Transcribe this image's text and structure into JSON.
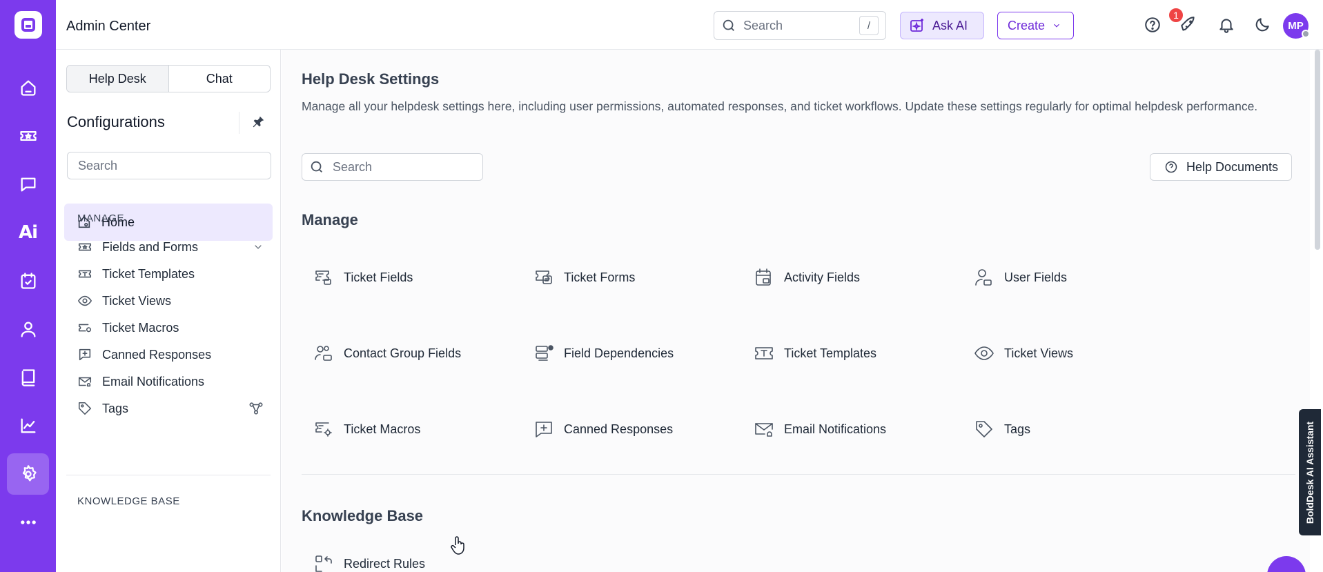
{
  "app": {
    "title": "Admin Center"
  },
  "topbar": {
    "search_placeholder": "Search",
    "search_shortcut": "/",
    "ask_ai_label": "Ask AI",
    "create_label": "Create",
    "notification_count": "1",
    "avatar_initials": "MP"
  },
  "sidebar": {
    "tabs": [
      "Help Desk",
      "Chat"
    ],
    "title": "Configurations",
    "search_placeholder": "Search",
    "home_label": "Home",
    "manage_heading": "MANAGE",
    "items": [
      "Fields and Forms",
      "Ticket Templates",
      "Ticket Views",
      "Ticket Macros",
      "Canned Responses",
      "Email Notifications",
      "Tags"
    ],
    "kb_heading": "KNOWLEDGE BASE"
  },
  "main": {
    "title": "Help Desk Settings",
    "description": "Manage all your helpdesk settings here, including user permissions, automated responses, and ticket workflows. Update these settings regularly for optimal helpdesk performance.",
    "search_placeholder": "Search",
    "help_docs_label": "Help Documents",
    "manage_title": "Manage",
    "manage_items": [
      "Ticket Fields",
      "Ticket Forms",
      "Activity Fields",
      "User Fields",
      "Contact Group Fields",
      "Field Dependencies",
      "Ticket Templates",
      "Ticket Views",
      "Ticket Macros",
      "Canned Responses",
      "Email Notifications",
      "Tags"
    ],
    "kb_title": "Knowledge Base",
    "kb_items": [
      "Redirect Rules"
    ]
  },
  "assistant_tab": "BoldDesk AI Assistant",
  "colors": {
    "brand": "#7c3aed",
    "active_bg": "#ede9fe",
    "badge": "#ef4444"
  }
}
